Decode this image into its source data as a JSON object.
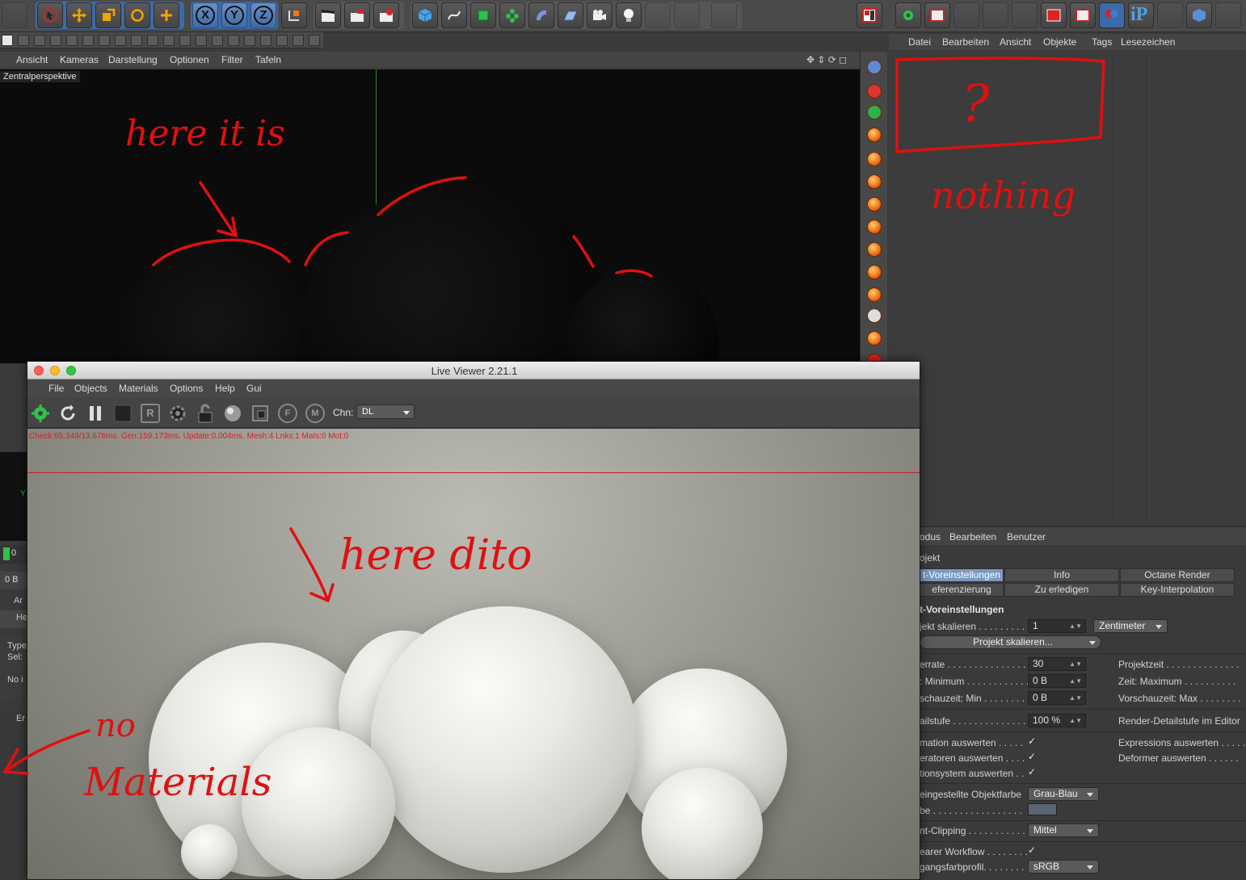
{
  "viewport": {
    "menu": [
      "Ansicht",
      "Kameras",
      "Darstellung",
      "Optionen",
      "Filter",
      "Tafeln"
    ],
    "label": "Zentralperspektive"
  },
  "toolbar": {
    "axis_x": "X",
    "axis_y": "Y",
    "axis_z": "Z"
  },
  "object_manager": {
    "menu": [
      "Datei",
      "Bearbeiten",
      "Ansicht",
      "Objekte",
      "Tags",
      "Lesezeichen"
    ]
  },
  "attribute_manager": {
    "menu": [
      "odus",
      "Bearbeiten",
      "Benutzer"
    ],
    "section_label": "ojekt",
    "tabs_row1": [
      "t-Voreinstellungen",
      "Info",
      "Octane Render"
    ],
    "tabs_row2": [
      "eferenzierung",
      "Zu erledigen",
      "Key-Interpolation"
    ],
    "group_title": "t-Voreinstellungen",
    "scale_label": "jekt skalieren . . . . . . . . .",
    "scale_value": "1",
    "scale_unit": "Zentimeter",
    "scale_button": "Projekt skalieren...",
    "fps_label": "errate . . . . . . . . . . . . . . . .",
    "fps_value": "30",
    "projektzeit_label": "Projektzeit . . . . . . . . . . . . . .",
    "min_label": ": Minimum . . . . . . . . . . . .",
    "min_value": "0 B",
    "max_label": "Zeit: Maximum . . . . . . . . . .",
    "pmin_label": "schauzeit: Min . . . . . . . .",
    "pmin_value": "0 B",
    "pmax_label": "Vorschauzeit: Max . . . . . . . .",
    "detail_label": "ailstufe . . . . . . . . . . . . . . .",
    "detail_value": "100 %",
    "render_detail_label": "Render-Detailstufe im Editor",
    "anim_label": "mation auswerten . . . . .",
    "expr_label": "Expressions auswerten . . . . .",
    "gen_label": "eratoren auswerten . . . .",
    "deform_label": "Deformer auswerten . . . . . .",
    "motion_label": "tionsystem auswerten . .",
    "color_label": "eingestellte Objektfarbe",
    "color_value": "Grau-Blau",
    "be_label": "be . . . . . . . . . . . . . . . . .",
    "clip_label": "nt-Clipping . . . . . . . . . . . .",
    "clip_value": "Mittel",
    "linear_label": "earer Workflow . . . . . . . .",
    "profile_label": "gangsfarbprofil. . . . . . . . .",
    "profile_value": "sRGB",
    "checkmark": "✓",
    "swatch_color": "#5a6472"
  },
  "left_stub": {
    "frame": "0",
    "size": "0 B",
    "ar": "Ar",
    "he": "He",
    "type": "Type",
    "sel": "Sel:",
    "no": "No i",
    "er": "Er",
    "y_axis": "Y"
  },
  "live_viewer": {
    "title": "Live Viewer 2.21.1",
    "menu": [
      "File",
      "Objects",
      "Materials",
      "Options",
      "Help",
      "Gui"
    ],
    "channel_label": "Chn:",
    "channel_value": "DL",
    "stats": "Check:65.349/13.678ms. Gen:159.173ms. Update:0.004ms. Mesh:4 Lnks:1 Mats:0 Mot:0",
    "icon_r": "R",
    "icon_f": "F",
    "icon_m": "M"
  },
  "annotations": {
    "here_it_is": "here it is",
    "nothing": "nothing",
    "question": "?",
    "here_dito": "here dito",
    "no": "no",
    "materials": "Materials"
  },
  "colors": {
    "annotation_red": "#e01010",
    "accent_blue": "#3d6aa8",
    "tab_active": "#7b98c0"
  }
}
